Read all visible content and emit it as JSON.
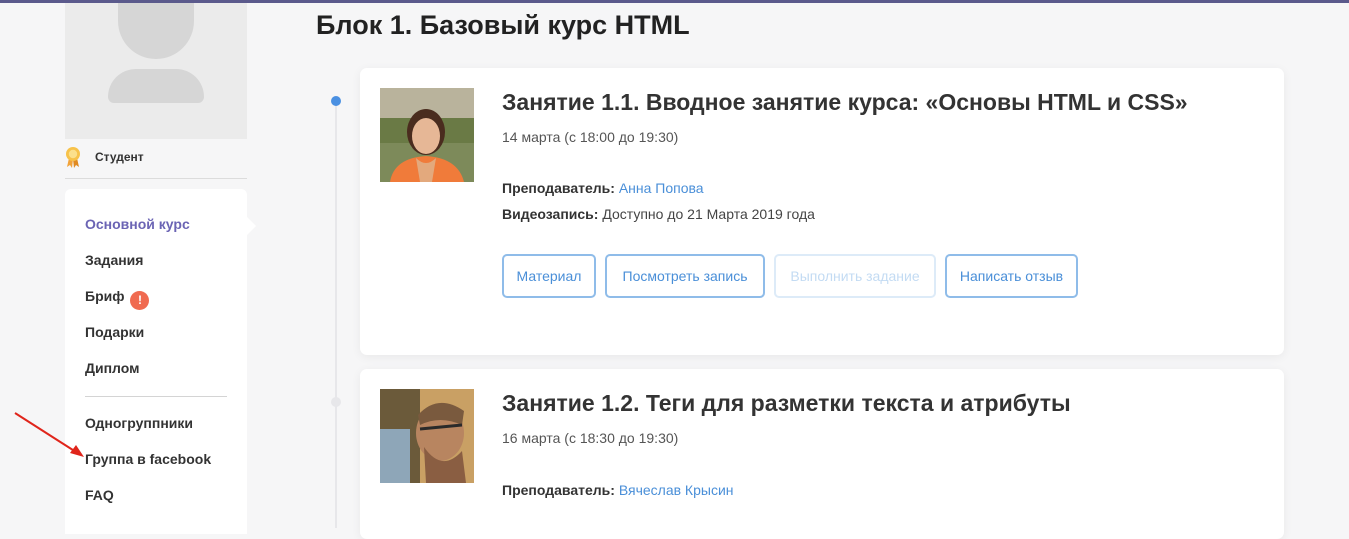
{
  "sidebar": {
    "role_label": "Студент",
    "menu": [
      {
        "label": "Основной курс",
        "active": true
      },
      {
        "label": "Задания"
      },
      {
        "label": "Бриф",
        "alert": "!"
      },
      {
        "label": "Подарки"
      },
      {
        "label": "Диплом"
      },
      {
        "label": "Одногруппники"
      },
      {
        "label": "Группа в facebook"
      },
      {
        "label": "FAQ"
      }
    ]
  },
  "main": {
    "block_title": "Блок 1. Базовый курс HTML",
    "lessons": [
      {
        "title": "Занятие 1.1. Вводное занятие курса: «Основы HTML и CSS»",
        "date": "14 марта (с 18:00 до 19:30)",
        "teacher_label": "Преподаватель:",
        "teacher_name": "Анна Попова",
        "video_label": "Видеозапись:",
        "video_value": "Доступно до 21 Марта 2019 года",
        "buttons": [
          {
            "label": "Материал",
            "enabled": true
          },
          {
            "label": "Посмотреть запись",
            "enabled": true
          },
          {
            "label": "Выполнить задание",
            "enabled": false
          },
          {
            "label": "Написать отзыв",
            "enabled": true
          }
        ]
      },
      {
        "title": "Занятие 1.2. Теги для разметки текста и атрибуты",
        "date": "16 марта (с 18:30 до 19:30)",
        "teacher_label": "Преподаватель:",
        "teacher_name": "Вячеслав Крысин"
      }
    ]
  },
  "colors": {
    "accent": "#6b64b4",
    "link": "#4a8fd8",
    "button_border": "#8fbce9",
    "alert": "#f06a50",
    "timeline_active": "#4a90e2",
    "annotation_arrow": "#e0251b"
  },
  "icons": [
    "user-placeholder-icon",
    "award-badge-icon",
    "alert-icon",
    "annotation-arrow"
  ]
}
